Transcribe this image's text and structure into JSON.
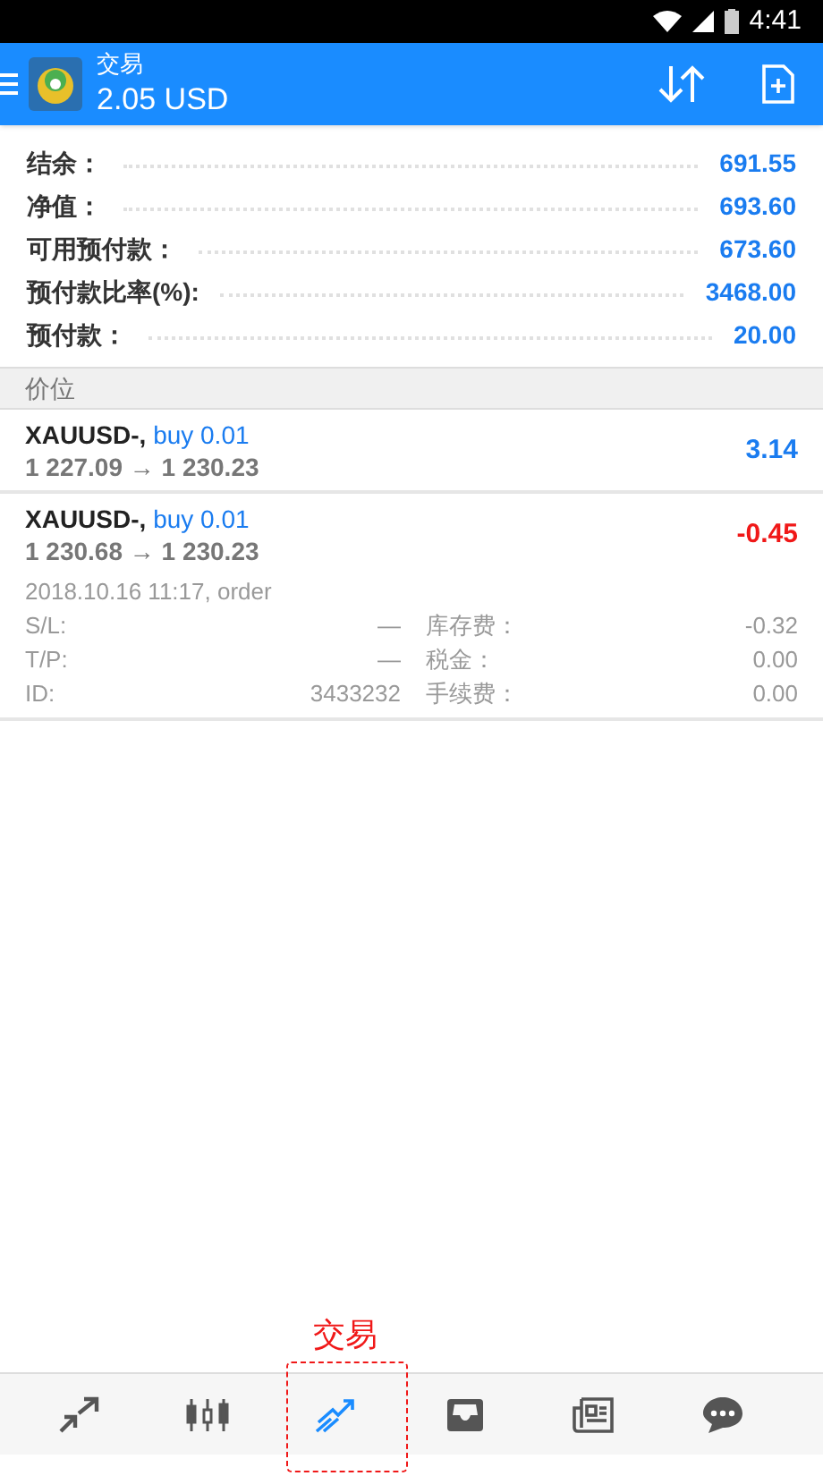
{
  "status_bar": {
    "time": "4:41"
  },
  "header": {
    "title": "交易",
    "subtitle": "2.05 USD"
  },
  "summary": [
    {
      "label": "结余：",
      "value": "691.55"
    },
    {
      "label": "净值：",
      "value": "693.60"
    },
    {
      "label": "可用预付款：",
      "value": "673.60"
    },
    {
      "label": "预付款比率(%):",
      "value": "3468.00"
    },
    {
      "label": "预付款：",
      "value": "20.00"
    }
  ],
  "section_title": "价位",
  "positions": [
    {
      "symbol": "XAUUSD-,",
      "side": "buy 0.01",
      "prices": "1 227.09 → 1 230.23",
      "profit": "3.14",
      "color": "#1a7cf0"
    },
    {
      "symbol": "XAUUSD-,",
      "side": "buy 0.01",
      "prices": "1 230.68 → 1 230.23",
      "profit": "-0.45",
      "color": "#f01818",
      "details": {
        "opened": "2018.10.16 11:17, order",
        "fields": [
          {
            "label": "S/L:",
            "value": "—",
            "label2": "库存费：",
            "value2": "-0.32"
          },
          {
            "label": "T/P:",
            "value": "—",
            "label2": "税金：",
            "value2": "0.00"
          },
          {
            "label": "ID:",
            "value": "3433232",
            "label2": "手续费：",
            "value2": "0.00"
          }
        ]
      }
    }
  ],
  "annotation": {
    "text": "交易"
  },
  "nav": [
    {
      "kind": "quotes",
      "selected": false
    },
    {
      "kind": "chart",
      "selected": false
    },
    {
      "kind": "trade",
      "selected": true
    },
    {
      "kind": "history",
      "selected": false
    },
    {
      "kind": "news",
      "selected": false
    },
    {
      "kind": "chat",
      "selected": false
    }
  ]
}
